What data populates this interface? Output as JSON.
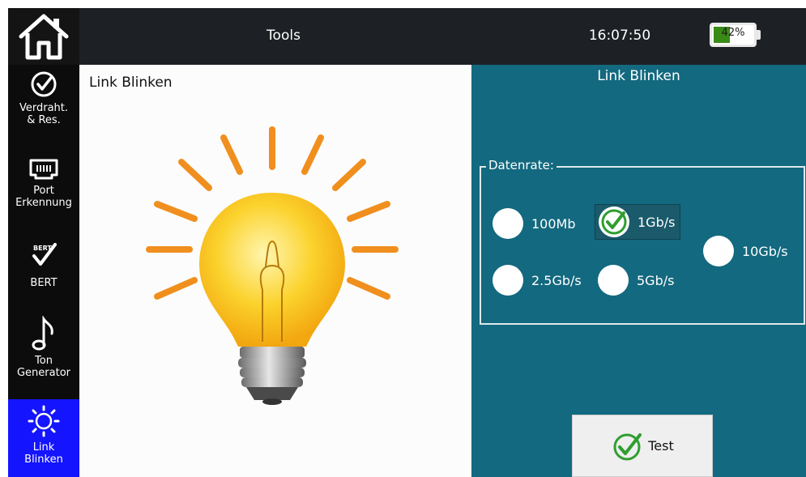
{
  "topbar": {
    "title": "Tools",
    "time": "16:07:50",
    "battery": {
      "label": "42%",
      "level": 0.42,
      "color": "#3a8a16"
    }
  },
  "sidebar": {
    "items": [
      {
        "label": "Verdraht.\n& Res.",
        "icon": "check-circle-icon",
        "active": false
      },
      {
        "label": "Port\nErkennung",
        "icon": "network-port-icon",
        "active": false
      },
      {
        "label": "BERT",
        "icon": "bert-icon",
        "active": false
      },
      {
        "label": "Ton\nGenerator",
        "icon": "music-note-icon",
        "active": false
      },
      {
        "label": "Link\nBlinken",
        "icon": "sun-icon",
        "active": true
      }
    ]
  },
  "main": {
    "title": "Link Blinken",
    "image": "lightbulb-icon"
  },
  "panel": {
    "title": "Link Blinken",
    "rate_label": "Datenrate:",
    "options": [
      {
        "label": "100Mb",
        "selected": false
      },
      {
        "label": "1Gb/s",
        "selected": true
      },
      {
        "label": "10Gb/s",
        "selected": false
      },
      {
        "label": "2.5Gb/s",
        "selected": false
      },
      {
        "label": "5Gb/s",
        "selected": false
      }
    ],
    "test_label": "Test"
  },
  "colors": {
    "panel_bg": "#13697f",
    "active_nav": "#1414ff",
    "check_green": "#2f9e2f",
    "bulb_yellow": "#f5c21a",
    "rays_orange": "#f08f1e"
  }
}
